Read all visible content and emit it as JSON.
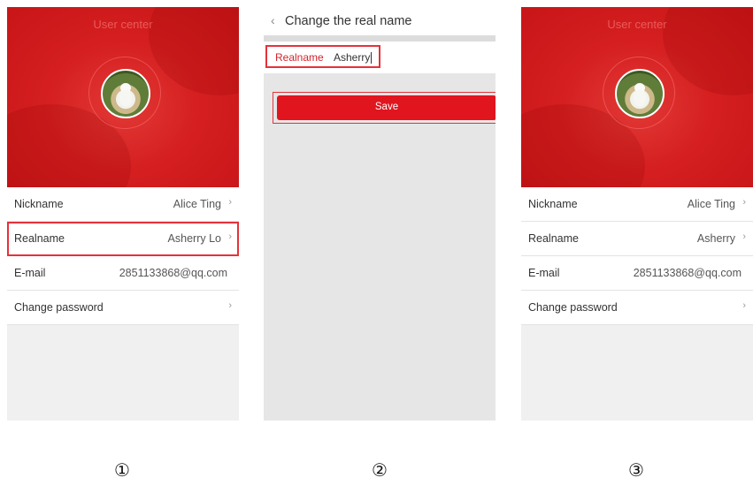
{
  "panel1": {
    "header_title": "User center",
    "rows": [
      {
        "label": "Nickname",
        "value": "Alice Ting"
      },
      {
        "label": "Realname",
        "value": "Asherry Lo"
      },
      {
        "label": "E-mail",
        "value": "2851133868@qq.com"
      },
      {
        "label": "Change password",
        "value": ""
      }
    ]
  },
  "panel2": {
    "back_icon": "‹",
    "title": "Change the real name",
    "field_label": "Realname",
    "field_value": "Asherry",
    "save_label": "Save"
  },
  "panel3": {
    "header_title": "User center",
    "rows": [
      {
        "label": "Nickname",
        "value": "Alice Ting"
      },
      {
        "label": "Realname",
        "value": "Asherry"
      },
      {
        "label": "E-mail",
        "value": "2851133868@qq.com"
      },
      {
        "label": "Change password",
        "value": ""
      }
    ]
  },
  "step_labels": [
    "①",
    "②",
    "③"
  ],
  "icons": {
    "chevron": "›"
  },
  "colors": {
    "brand_red": "#e0151e",
    "highlight_red": "#e5323a"
  }
}
